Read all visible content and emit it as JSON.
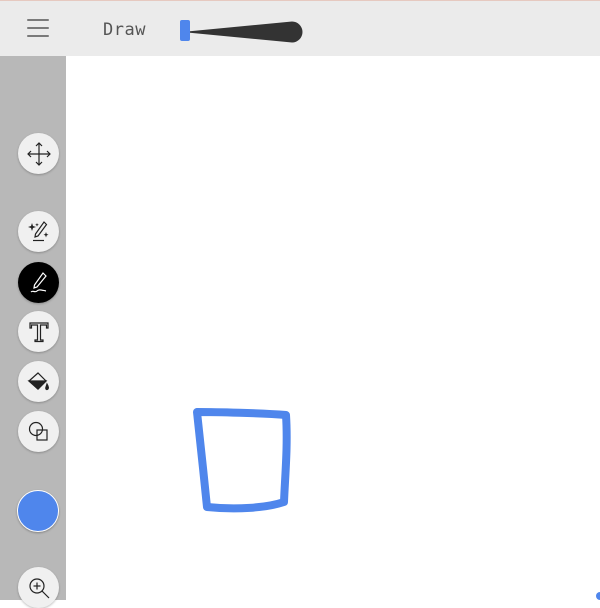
{
  "header": {
    "title": "Draw",
    "menu_icon": "hamburger-menu-icon",
    "size_slider": {
      "icon": "brush-size-slider",
      "value": 0.05,
      "thumb_color": "#4f86ec",
      "track_color": "#333333"
    }
  },
  "tools": [
    {
      "name": "pan-tool",
      "icon": "move-arrows-icon",
      "active": false
    },
    {
      "name": "magic-pen-tool",
      "icon": "sparkle-pen-icon",
      "active": false
    },
    {
      "name": "pen-tool",
      "icon": "pen-icon",
      "active": true
    },
    {
      "name": "text-tool",
      "icon": "text-t-icon",
      "active": false
    },
    {
      "name": "fill-tool",
      "icon": "paint-bucket-icon",
      "active": false
    },
    {
      "name": "shapes-tool",
      "icon": "shapes-icon",
      "active": false
    },
    {
      "name": "zoom-tool",
      "icon": "zoom-in-icon",
      "active": false
    }
  ],
  "current_color": "#4f86ec",
  "canvas": {
    "stroke_color": "#4f86ec"
  }
}
